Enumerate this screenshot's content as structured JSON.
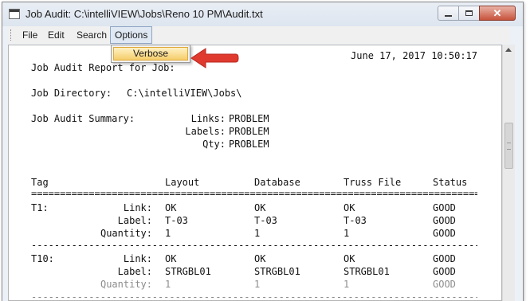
{
  "window": {
    "title": "Job Audit: C:\\intelliVIEW\\Jobs\\Reno 10 PM\\Audit.txt",
    "buttons": {
      "minimize": "minimize",
      "maximize": "maximize",
      "close": "✕"
    }
  },
  "menu": {
    "file": "File",
    "edit": "Edit",
    "search": "Search",
    "options": "Options",
    "options_dropdown": {
      "verbose": "Verbose"
    }
  },
  "report": {
    "date": "June 17, 2017 10:50:17",
    "header_line": "Job Audit Report for Job:",
    "directory_label": "Job Directory:",
    "directory": "C:\\intelliVIEW\\Jobs\\",
    "summary_label": "Job Audit Summary:",
    "summary": [
      {
        "label": "Links:",
        "value": "PROBLEM"
      },
      {
        "label": "Labels:",
        "value": "PROBLEM"
      },
      {
        "label": "Qty:",
        "value": "PROBLEM"
      }
    ],
    "columns": {
      "tag": "Tag",
      "layout": "Layout",
      "database": "Database",
      "truss_file": "Truss File",
      "status": "Status"
    },
    "double_rule": "===================================================================================",
    "single_rule": "-----------------------------------------------------------------------------------",
    "groups": [
      {
        "tag": "T1:",
        "rows": [
          {
            "label": "Link:",
            "layout": "OK",
            "database": "OK",
            "truss": "OK",
            "status": "GOOD"
          },
          {
            "label": "Label:",
            "layout": "T-03",
            "database": "T-03",
            "truss": "T-03",
            "status": "GOOD"
          },
          {
            "label": "Quantity:",
            "layout": "1",
            "database": "1",
            "truss": "1",
            "status": "GOOD"
          }
        ]
      },
      {
        "tag": "T10:",
        "rows": [
          {
            "label": "Link:",
            "layout": "OK",
            "database": "OK",
            "truss": "OK",
            "status": "GOOD"
          },
          {
            "label": "Label:",
            "layout": "STRGBL01",
            "database": "STRGBL01",
            "truss": "STRGBL01",
            "status": "GOOD"
          },
          {
            "label": "Quantity:",
            "layout": "1",
            "database": "1",
            "truss": "1",
            "status": "GOOD"
          }
        ]
      }
    ]
  },
  "colors": {
    "highlight": "#f5cd6b",
    "arrow": "#e03a2f"
  }
}
